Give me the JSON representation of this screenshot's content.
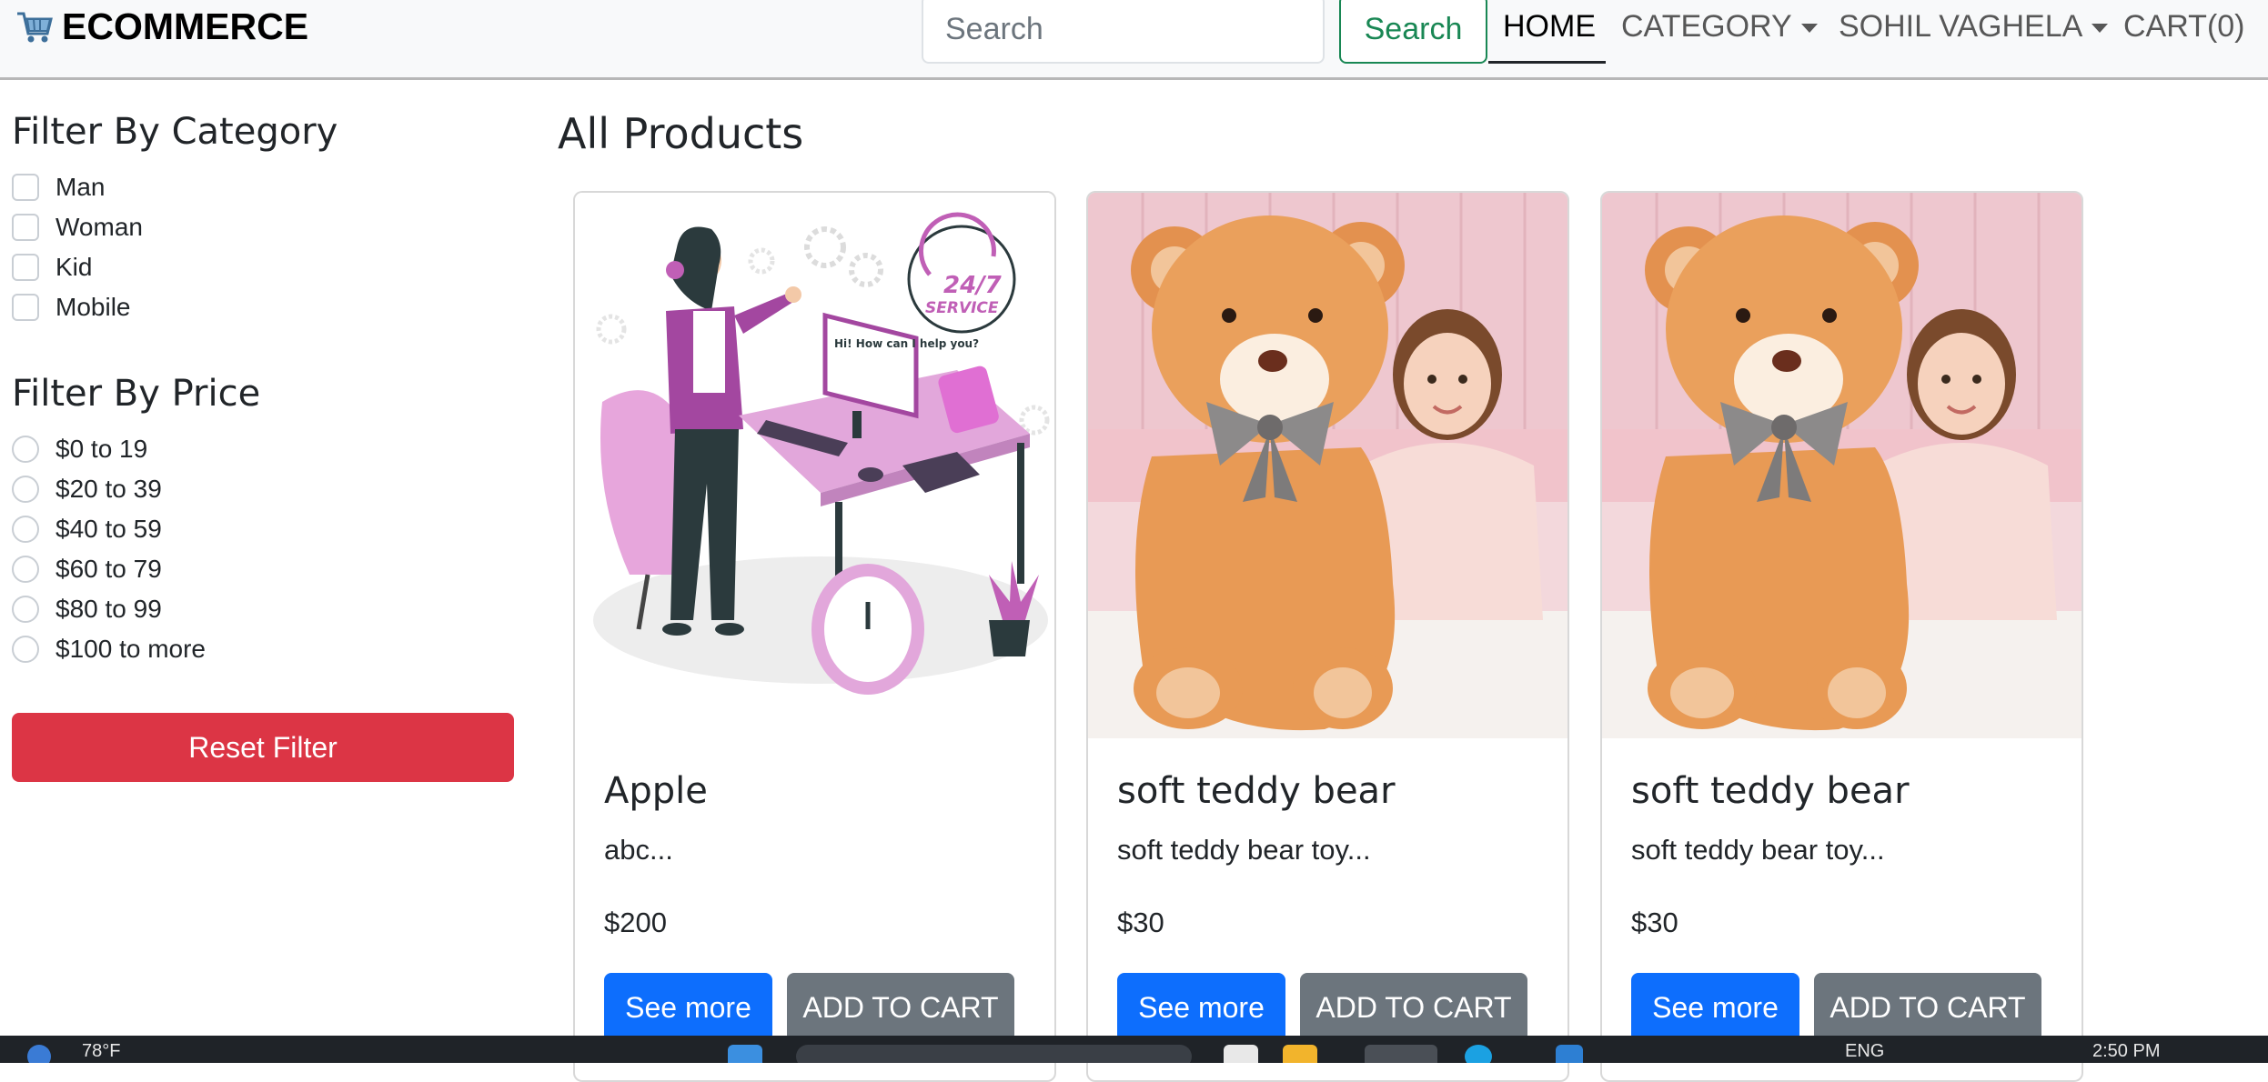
{
  "navbar": {
    "brand": "ECOMMERCE",
    "brand_icon": "cart-icon",
    "search_placeholder": "Search",
    "search_button": "Search",
    "links": {
      "home": "HOME",
      "category": "CATEGORY",
      "user": "SOHIL VAGHELA",
      "cart": "CART(0)"
    }
  },
  "sidebar": {
    "category_title": "Filter By Category",
    "categories": [
      "Man",
      "Woman",
      "Kid",
      "Mobile"
    ],
    "price_title": "Filter By Price",
    "prices": [
      "$0 to 19",
      "$20 to 39",
      "$40 to 59",
      "$60 to 79",
      "$80 to 99",
      "$100 to more"
    ],
    "reset_button": "Reset Filter"
  },
  "main": {
    "title": "All Products",
    "products": [
      {
        "name": "Apple",
        "description": "abc...",
        "price": "$200",
        "see_more": "See more",
        "add_to_cart": "ADD TO CART",
        "image": "customer-service-illustration"
      },
      {
        "name": "soft teddy bear",
        "description": "soft teddy bear toy...",
        "price": "$30",
        "see_more": "See more",
        "add_to_cart": "ADD TO CART",
        "image": "teddy-bear-photo"
      },
      {
        "name": "soft teddy bear",
        "description": "soft teddy bear toy...",
        "price": "$30",
        "see_more": "See more",
        "add_to_cart": "ADD TO CART",
        "image": "teddy-bear-photo"
      }
    ]
  },
  "illustration": {
    "speech_bubble": "Hi! How can I help you?",
    "badge_top": "24/7",
    "badge_bottom": "SERVICE"
  },
  "taskbar": {
    "weather": "78°F",
    "language": "ENG",
    "time": "2:50 PM"
  },
  "colors": {
    "danger": "#dc3545",
    "primary": "#0d6efd",
    "secondary": "#6c757d",
    "success": "#198754"
  }
}
